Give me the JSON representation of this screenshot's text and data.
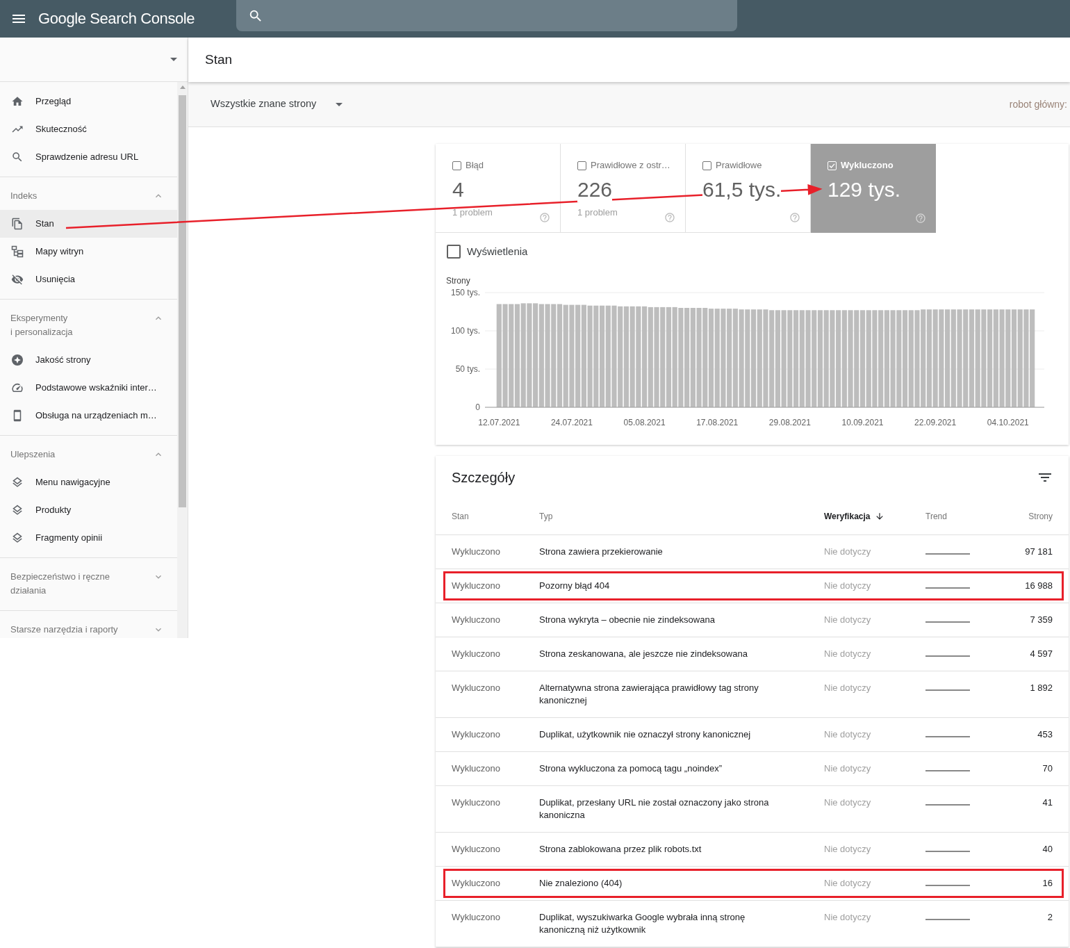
{
  "top_bar": {
    "title": "Google Search Console"
  },
  "sidebar": {
    "groups": [
      {
        "items": [
          {
            "label": "Przegląd",
            "selected": false
          },
          {
            "label": "Skuteczność",
            "selected": false
          },
          {
            "label": "Sprawdzenie adresu URL",
            "selected": false
          }
        ]
      },
      {
        "title": "Indeks",
        "expanded": true,
        "items": [
          {
            "label": "Stan",
            "selected": true
          },
          {
            "label": "Mapy witryn",
            "selected": false
          },
          {
            "label": "Usunięcia",
            "selected": false
          }
        ]
      },
      {
        "title": "Eksperymenty i personalizacja",
        "expanded": true,
        "items": [
          {
            "label": "Jakość strony",
            "selected": false
          },
          {
            "label": "Podstawowe wskaźniki inter…",
            "selected": false
          },
          {
            "label": "Obsługa na urządzeniach m…",
            "selected": false
          }
        ]
      },
      {
        "title": "Ulepszenia",
        "expanded": true,
        "items": [
          {
            "label": "Menu nawigacyjne",
            "selected": false
          },
          {
            "label": "Produkty",
            "selected": false
          },
          {
            "label": "Fragmenty opinii",
            "selected": false
          }
        ]
      },
      {
        "title": "Bezpieczeństwo i ręczne działania",
        "expanded": false
      },
      {
        "title": "Starsze narzędzia i raporty",
        "expanded": false
      }
    ]
  },
  "page_header": {
    "title": "Stan"
  },
  "filter_bar": {
    "dropdown": "Wszystkie znane strony",
    "crawler": "robot główny:"
  },
  "summary_cards": [
    {
      "label": "Błąd",
      "value": "4",
      "detail": "1 problem",
      "checked": false
    },
    {
      "label": "Prawidłowe z ostr…",
      "value": "226",
      "detail": "1 problem",
      "checked": false
    },
    {
      "label": "Prawidłowe",
      "value": "61,5 tys.",
      "checked": false
    },
    {
      "label": "Wykluczono",
      "value": "129 tys.",
      "checked": true
    }
  ],
  "impressions_toggle": {
    "label": "Wyświetlenia",
    "checked": false
  },
  "chart": {
    "chart_data": {
      "type": "bar",
      "ylabel": "Strony",
      "ylim": [
        0,
        150
      ],
      "yticks": [
        {
          "value": 0,
          "label": "0"
        },
        {
          "value": 50,
          "label": "50 tys."
        },
        {
          "value": 100,
          "label": "100 tys."
        },
        {
          "value": 150,
          "label": "150 tys."
        }
      ],
      "categories": [
        "12.07.2021",
        null,
        null,
        null,
        null,
        null,
        null,
        null,
        null,
        null,
        null,
        null,
        "24.07.2021",
        null,
        null,
        null,
        null,
        null,
        null,
        null,
        null,
        null,
        null,
        null,
        "05.08.2021",
        null,
        null,
        null,
        null,
        null,
        null,
        null,
        null,
        null,
        null,
        null,
        "17.08.2021",
        null,
        null,
        null,
        null,
        null,
        null,
        null,
        null,
        null,
        null,
        null,
        "29.08.2021",
        null,
        null,
        null,
        null,
        null,
        null,
        null,
        null,
        null,
        null,
        null,
        "10.09.2021",
        null,
        null,
        null,
        null,
        null,
        null,
        null,
        null,
        null,
        null,
        null,
        "22.09.2021",
        null,
        null,
        null,
        null,
        null,
        null,
        null,
        null,
        null,
        null,
        null,
        "04.10.2021",
        null,
        null,
        null,
        null
      ],
      "values": [
        135,
        135,
        135,
        135,
        136,
        136,
        136,
        135,
        135,
        135,
        135,
        134,
        134,
        134,
        134,
        133,
        133,
        133,
        133,
        133,
        132,
        132,
        132,
        132,
        132,
        131,
        131,
        131,
        131,
        131,
        130,
        130,
        130,
        130,
        130,
        129,
        129,
        129,
        129,
        129,
        128,
        128,
        128,
        128,
        128,
        127,
        127,
        127,
        127,
        127,
        127,
        127,
        127,
        127,
        127,
        127,
        127,
        127,
        127,
        127,
        127,
        127,
        127,
        127,
        127,
        127,
        127,
        127,
        127,
        127,
        128,
        128,
        128,
        128,
        128,
        128,
        128,
        128,
        128,
        128,
        128,
        128,
        128,
        128,
        128,
        128,
        128,
        128,
        128
      ]
    }
  },
  "details": {
    "title": "Szczegóły",
    "columns": [
      {
        "label": "Stan",
        "sorted": false
      },
      {
        "label": "Typ",
        "sorted": false
      },
      {
        "label": "Weryfikacja",
        "sorted": true
      },
      {
        "label": "Trend",
        "sorted": false
      },
      {
        "label": "Strony",
        "sorted": false
      }
    ],
    "rows": [
      {
        "status": "Wykluczono",
        "type": "Strona zawiera przekierowanie",
        "validation": "Nie dotyczy",
        "pages": "97 181",
        "highlighted": false
      },
      {
        "status": "Wykluczono",
        "type": "Pozorny błąd 404",
        "validation": "Nie dotyczy",
        "pages": "16 988",
        "highlighted": true
      },
      {
        "status": "Wykluczono",
        "type": "Strona wykryta – obecnie nie zindeksowana",
        "validation": "Nie dotyczy",
        "pages": "7 359",
        "highlighted": false
      },
      {
        "status": "Wykluczono",
        "type": "Strona zeskanowana, ale jeszcze nie zindeksowana",
        "validation": "Nie dotyczy",
        "pages": "4 597",
        "highlighted": false
      },
      {
        "status": "Wykluczono",
        "type": "Alternatywna strona zawierająca prawidłowy tag strony kanonicznej",
        "validation": "Nie dotyczy",
        "pages": "1 892",
        "highlighted": false
      },
      {
        "status": "Wykluczono",
        "type": "Duplikat, użytkownik nie oznaczył strony kanonicznej",
        "validation": "Nie dotyczy",
        "pages": "453",
        "highlighted": false
      },
      {
        "status": "Wykluczono",
        "type": "Strona wykluczona za pomocą tagu „noindex”",
        "validation": "Nie dotyczy",
        "pages": "70",
        "highlighted": false
      },
      {
        "status": "Wykluczono",
        "type": "Duplikat, przesłany URL nie został oznaczony jako strona kanoniczna",
        "validation": "Nie dotyczy",
        "pages": "41",
        "highlighted": false
      },
      {
        "status": "Wykluczono",
        "type": "Strona zablokowana przez plik robots.txt",
        "validation": "Nie dotyczy",
        "pages": "40",
        "highlighted": false
      },
      {
        "status": "Wykluczono",
        "type": "Nie znaleziono (404)",
        "validation": "Nie dotyczy",
        "pages": "16",
        "highlighted": true
      },
      {
        "status": "Wykluczono",
        "type": "Duplikat, wyszukiwarka Google wybrała inną stronę kanoniczną niż użytkownik",
        "validation": "Nie dotyczy",
        "pages": "2",
        "highlighted": false
      }
    ]
  }
}
